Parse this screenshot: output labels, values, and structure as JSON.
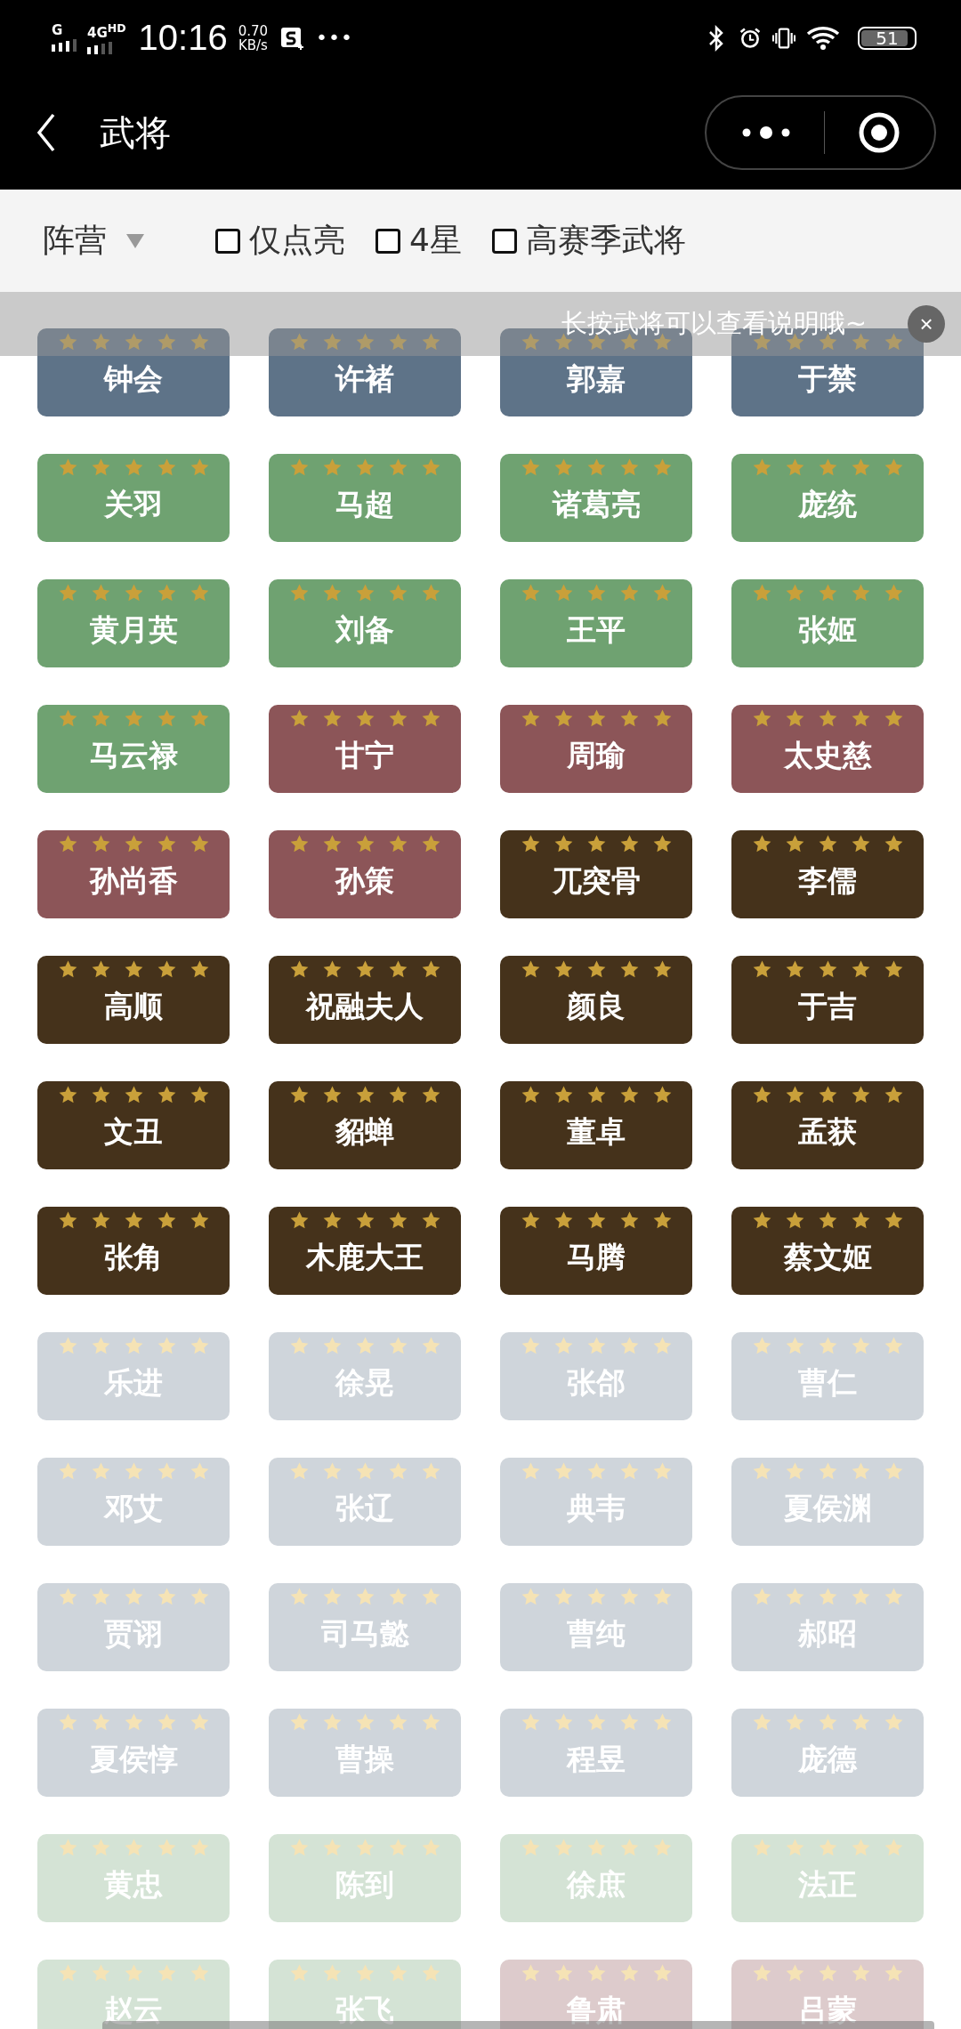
{
  "status_bar": {
    "network_1": "G",
    "network_2": "4G$^{HD}$",
    "time": "10:16",
    "speed": "0.70",
    "speed_unit": "KB/s",
    "more": "•••",
    "battery": "51"
  },
  "nav": {
    "title": "武将"
  },
  "filters": {
    "dropdown": "阵营",
    "checkboxes": [
      {
        "label": "仅点亮",
        "checked": false
      },
      {
        "label": "4星",
        "checked": false
      },
      {
        "label": "高赛季武将",
        "checked": false
      }
    ]
  },
  "tip": {
    "text": "长按武将可以查看说明哦~",
    "close": "×"
  },
  "generals": [
    {
      "name": "钟会",
      "color": "#5e7388",
      "lit": true,
      "stars": 5
    },
    {
      "name": "许褚",
      "color": "#5e7388",
      "lit": true,
      "stars": 5
    },
    {
      "name": "郭嘉",
      "color": "#5e7388",
      "lit": true,
      "stars": 5
    },
    {
      "name": "于禁",
      "color": "#5e7388",
      "lit": true,
      "stars": 5
    },
    {
      "name": "关羽",
      "color": "#6fa271",
      "lit": true,
      "stars": 5
    },
    {
      "name": "马超",
      "color": "#6fa271",
      "lit": true,
      "stars": 5
    },
    {
      "name": "诸葛亮",
      "color": "#6fa271",
      "lit": true,
      "stars": 5
    },
    {
      "name": "庞统",
      "color": "#6fa271",
      "lit": true,
      "stars": 5
    },
    {
      "name": "黄月英",
      "color": "#6fa271",
      "lit": true,
      "stars": 5
    },
    {
      "name": "刘备",
      "color": "#6fa271",
      "lit": true,
      "stars": 5
    },
    {
      "name": "王平",
      "color": "#6fa271",
      "lit": true,
      "stars": 5
    },
    {
      "name": "张姬",
      "color": "#6fa271",
      "lit": true,
      "stars": 5
    },
    {
      "name": "马云禄",
      "color": "#6fa271",
      "lit": true,
      "stars": 5
    },
    {
      "name": "甘宁",
      "color": "#8c5558",
      "lit": true,
      "stars": 5
    },
    {
      "name": "周瑜",
      "color": "#8c5558",
      "lit": true,
      "stars": 5
    },
    {
      "name": "太史慈",
      "color": "#8c5558",
      "lit": true,
      "stars": 5
    },
    {
      "name": "孙尚香",
      "color": "#8c5558",
      "lit": true,
      "stars": 5
    },
    {
      "name": "孙策",
      "color": "#8c5558",
      "lit": true,
      "stars": 5
    },
    {
      "name": "兀突骨",
      "color": "#45321b",
      "lit": true,
      "stars": 5
    },
    {
      "name": "李儒",
      "color": "#45321b",
      "lit": true,
      "stars": 5
    },
    {
      "name": "高顺",
      "color": "#45321b",
      "lit": true,
      "stars": 5
    },
    {
      "name": "祝融夫人",
      "color": "#45321b",
      "lit": true,
      "stars": 5
    },
    {
      "name": "颜良",
      "color": "#45321b",
      "lit": true,
      "stars": 5
    },
    {
      "name": "于吉",
      "color": "#45321b",
      "lit": true,
      "stars": 5
    },
    {
      "name": "文丑",
      "color": "#45321b",
      "lit": true,
      "stars": 5
    },
    {
      "name": "貂蝉",
      "color": "#45321b",
      "lit": true,
      "stars": 5
    },
    {
      "name": "董卓",
      "color": "#45321b",
      "lit": true,
      "stars": 5
    },
    {
      "name": "孟获",
      "color": "#45321b",
      "lit": true,
      "stars": 5
    },
    {
      "name": "张角",
      "color": "#45321b",
      "lit": true,
      "stars": 5
    },
    {
      "name": "木鹿大王",
      "color": "#45321b",
      "lit": true,
      "stars": 5
    },
    {
      "name": "马腾",
      "color": "#45321b",
      "lit": true,
      "stars": 5
    },
    {
      "name": "蔡文姬",
      "color": "#45321b",
      "lit": true,
      "stars": 5
    },
    {
      "name": "乐进",
      "color": "#cfd5db",
      "lit": false,
      "stars": 5
    },
    {
      "name": "徐晃",
      "color": "#cfd5db",
      "lit": false,
      "stars": 5
    },
    {
      "name": "张郃",
      "color": "#cfd5db",
      "lit": false,
      "stars": 5
    },
    {
      "name": "曹仁",
      "color": "#cfd5db",
      "lit": false,
      "stars": 5
    },
    {
      "name": "邓艾",
      "color": "#cfd5db",
      "lit": false,
      "stars": 5
    },
    {
      "name": "张辽",
      "color": "#cfd5db",
      "lit": false,
      "stars": 5
    },
    {
      "name": "典韦",
      "color": "#cfd5db",
      "lit": false,
      "stars": 5
    },
    {
      "name": "夏侯渊",
      "color": "#cfd5db",
      "lit": false,
      "stars": 5
    },
    {
      "name": "贾诩",
      "color": "#cfd5db",
      "lit": false,
      "stars": 5
    },
    {
      "name": "司马懿",
      "color": "#cfd5db",
      "lit": false,
      "stars": 5
    },
    {
      "name": "曹纯",
      "color": "#cfd5db",
      "lit": false,
      "stars": 5
    },
    {
      "name": "郝昭",
      "color": "#cfd5db",
      "lit": false,
      "stars": 5
    },
    {
      "name": "夏侯惇",
      "color": "#cfd5db",
      "lit": false,
      "stars": 5
    },
    {
      "name": "曹操",
      "color": "#cfd5db",
      "lit": false,
      "stars": 5
    },
    {
      "name": "程昱",
      "color": "#cfd5db",
      "lit": false,
      "stars": 5
    },
    {
      "name": "庞德",
      "color": "#cfd5db",
      "lit": false,
      "stars": 5
    },
    {
      "name": "黄忠",
      "color": "#d4e3d5",
      "lit": false,
      "stars": 5
    },
    {
      "name": "陈到",
      "color": "#d4e3d5",
      "lit": false,
      "stars": 5
    },
    {
      "name": "徐庶",
      "color": "#d4e3d5",
      "lit": false,
      "stars": 5
    },
    {
      "name": "法正",
      "color": "#d4e3d5",
      "lit": false,
      "stars": 5
    },
    {
      "name": "赵云",
      "color": "#d4e3d5",
      "lit": false,
      "stars": 5
    },
    {
      "name": "张飞",
      "color": "#d4e3d5",
      "lit": false,
      "stars": 5
    },
    {
      "name": "鲁肃",
      "color": "#ddcbcc",
      "lit": false,
      "stars": 5
    },
    {
      "name": "吕蒙",
      "color": "#ddcbcc",
      "lit": false,
      "stars": 5
    }
  ]
}
